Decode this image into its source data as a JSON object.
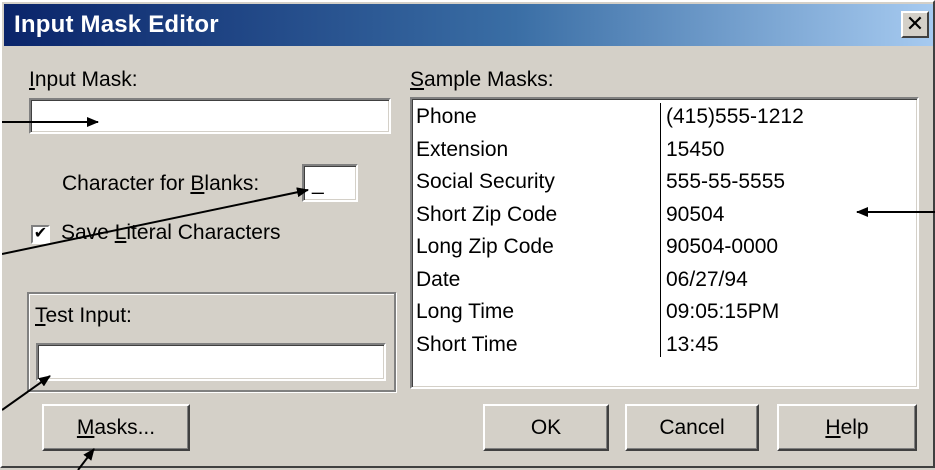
{
  "window": {
    "title": "Input Mask Editor",
    "close_glyph": "✕"
  },
  "input_mask": {
    "label": "Input Mask:",
    "value": ""
  },
  "blanks": {
    "label": "Character for Blanks:",
    "value": "_"
  },
  "save_literal": {
    "label": "Save Literal Characters",
    "checked": true,
    "check_glyph": "✔"
  },
  "test_input": {
    "label": "Test Input:",
    "value": ""
  },
  "sample_masks": {
    "label": "Sample Masks:",
    "rows": [
      {
        "name": "Phone",
        "sample": "(415)555-1212"
      },
      {
        "name": "Extension",
        "sample": "15450"
      },
      {
        "name": "Social Security",
        "sample": "555-55-5555"
      },
      {
        "name": "Short Zip Code",
        "sample": "90504"
      },
      {
        "name": "Long Zip Code",
        "sample": "90504-0000"
      },
      {
        "name": "Date",
        "sample": "06/27/94"
      },
      {
        "name": "Long Time",
        "sample": "09:05:15PM"
      },
      {
        "name": "Short Time",
        "sample": "13:45"
      }
    ]
  },
  "buttons": {
    "masks": "Masks...",
    "ok": "OK",
    "cancel": "Cancel",
    "help": "Help"
  },
  "colors": {
    "face": "#d4d0c8",
    "title_start": "#0a246a",
    "title_end": "#a6caf0"
  }
}
